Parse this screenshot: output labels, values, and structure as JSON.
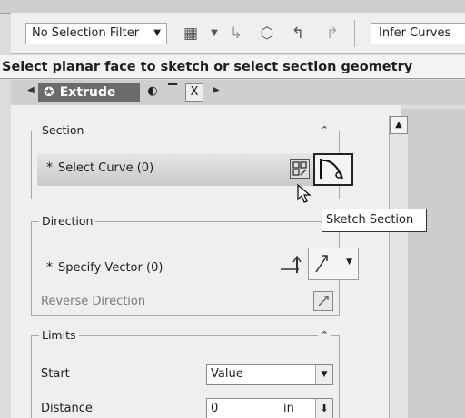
{
  "toolbar": {
    "selection_filter": "No Selection Filter",
    "infer_curves": "Infer Curves"
  },
  "cue_line": "Select planar face to sketch or select section geometry",
  "tab": {
    "title": "Extrude",
    "close_glyph": "X"
  },
  "section": {
    "title": "Section",
    "select_curve_label": "Select Curve (0)",
    "required_marker": "*",
    "tooltip": "Sketch Section"
  },
  "direction": {
    "title": "Direction",
    "specify_vector_label": "Specify Vector (0)",
    "required_marker": "*",
    "reverse_label": "Reverse Direction"
  },
  "limits": {
    "title": "Limits",
    "start_label": "Start",
    "start_value": "Value",
    "distance_label": "Distance",
    "distance_value": "0",
    "distance_unit": "in"
  },
  "icons": {
    "filter_dropdown": "chevron-down-icon",
    "collapse": "chevron-up-icon",
    "sketch_section": "sketch-section-icon",
    "curve": "curve-icon"
  }
}
